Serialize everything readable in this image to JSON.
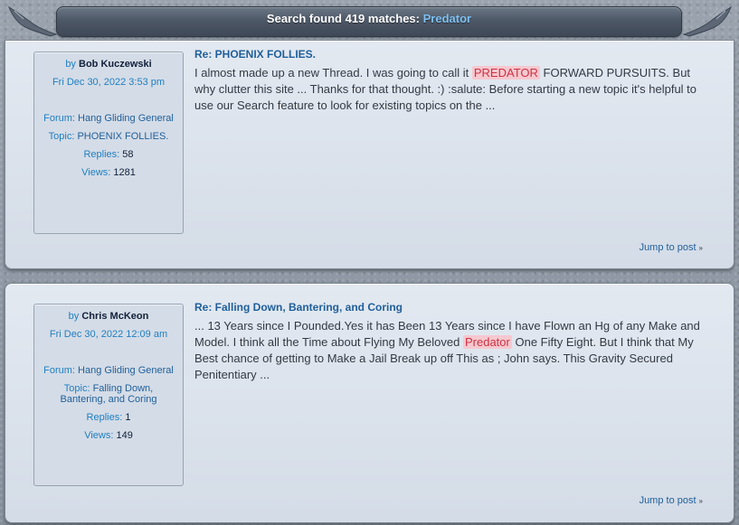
{
  "header": {
    "title_prefix": "Search found 419 matches:",
    "keyword": "Predator"
  },
  "labels": {
    "by": "by",
    "forum": "Forum:",
    "topic": "Topic:",
    "replies": "Replies:",
    "views": "Views:",
    "jump_to_post": "Jump to post",
    "jump_icon": "»"
  },
  "results": [
    {
      "author": "Bob Kuczewski",
      "date": "Fri Dec 30, 2022 3:53 pm",
      "forum": "Hang Gliding General",
      "topic": "PHOENIX FOLLIES.",
      "replies": "58",
      "views": "1281",
      "title": "Re: PHOENIX FOLLIES.",
      "body_before": "I almost made up a new Thread. I was going to call it ",
      "body_highlight": "PREDATOR",
      "body_after": " FORWARD PURSUITS. But why clutter this site ... Thanks for that thought. :) :salute: Before starting a new topic it's helpful to use our Search feature to look for existing topics on the ..."
    },
    {
      "author": "Chris McKeon",
      "date": "Fri Dec 30, 2022 12:09 am",
      "forum": "Hang Gliding General",
      "topic": "Falling Down, Bantering, and Coring",
      "replies": "1",
      "views": "149",
      "title": "Re: Falling Down, Bantering, and Coring",
      "body_before": "... 13 Years since I Pounded.Yes it has Been 13 Years since I have Flown an Hg of any Make and Model. I think all the Time about Flying My Beloved ",
      "body_highlight": "Predator",
      "body_after": " One Fifty Eight. But I think that My Best chance of getting to Make a Jail Break up off This as ; John says. This Gravity Secured Penitentiary ..."
    }
  ]
}
